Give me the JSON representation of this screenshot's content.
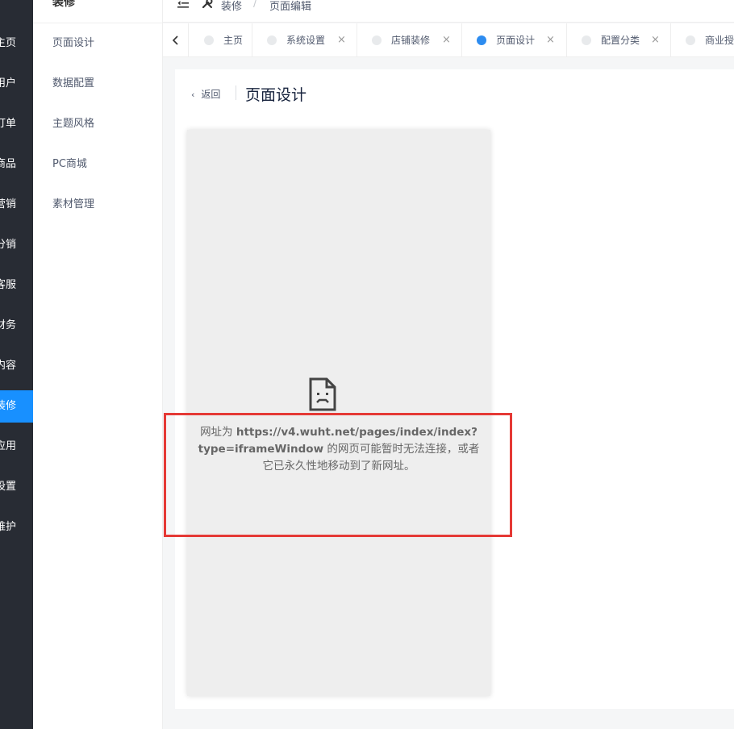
{
  "main_nav": {
    "items": [
      "主页",
      "用户",
      "订单",
      "商品",
      "营销",
      "分销",
      "客服",
      "财务",
      "内容",
      "装修",
      "应用",
      "设置",
      "维护"
    ],
    "active_index": 9,
    "active_color": "#1890ff",
    "bg_color": "#282c34"
  },
  "sub_nav": {
    "title": "装修",
    "items": [
      "页面设计",
      "数据配置",
      "主题风格",
      "PC商城",
      "素材管理"
    ]
  },
  "header": {
    "collapse_icon": "menu-fold-icon",
    "breadcrumb_icon": "tools-icon",
    "breadcrumb": [
      "装修",
      "页面编辑"
    ],
    "separator": "/"
  },
  "tabs": {
    "items": [
      {
        "label": "主页",
        "closable": false,
        "active": false
      },
      {
        "label": "系统设置",
        "closable": true,
        "active": false
      },
      {
        "label": "店铺装修",
        "closable": true,
        "active": false
      },
      {
        "label": "页面设计",
        "closable": true,
        "active": true
      },
      {
        "label": "配置分类",
        "closable": true,
        "active": false
      },
      {
        "label": "商业授权",
        "closable": true,
        "active": false
      }
    ],
    "close_glyph": "×",
    "prev_glyph": "‹"
  },
  "page": {
    "back_label": "返回",
    "back_glyph": "‹",
    "title": "页面设计"
  },
  "preview": {
    "error_prefix": "网址为 ",
    "error_url": "https://v4.wuht.net/pages/index/index?type=iframeWindow",
    "error_suffix": " 的网页可能暂时无法连接，或者它已永久性地移动到了新网址。",
    "icon": "broken-page-icon"
  },
  "highlight_color": "#e53935"
}
